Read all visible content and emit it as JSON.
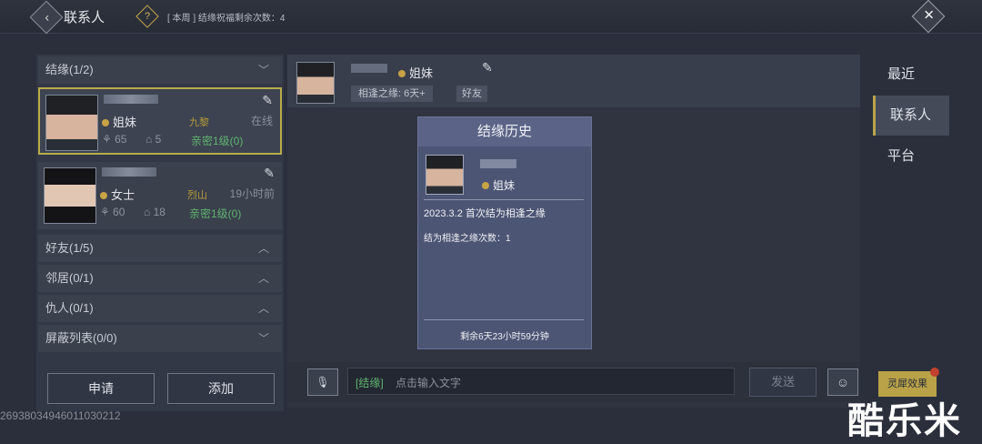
{
  "header": {
    "back_icon": "chevron-left-icon",
    "title": "联系人",
    "help_icon": "question-icon",
    "week_note": "[ 本周 ] 结缘祝福剩余次数：4",
    "close_icon": "close-icon"
  },
  "groups": {
    "jieyuan": "结缘(1/2)",
    "friends": "好友(1/5)",
    "neighbors": "邻居(0/1)",
    "enemies": "仇人(0/1)",
    "blocked": "屏蔽列表(0/0)"
  },
  "contacts": [
    {
      "relation": "姐妹",
      "school": "九黎",
      "status": "在线",
      "stat1": "65",
      "stat2": "5",
      "intimacy": "亲密1级(0)"
    },
    {
      "relation": "女士",
      "school": "烈山",
      "status": "19小时前",
      "stat1": "60",
      "stat2": "18",
      "intimacy": "亲密1级(0)"
    }
  ],
  "buttons": {
    "apply": "申请",
    "add": "添加",
    "send": "发送",
    "effect": "灵犀效果"
  },
  "id_text": "2693803494601103021​2",
  "chat": {
    "relation": "姐妹",
    "tag_meet": "相逢之缘: 6天+",
    "tag_friend": "好友",
    "channel": "[结缘]",
    "placeholder": "点击输入文字"
  },
  "history": {
    "title": "结缘历史",
    "relation": "姐妹",
    "date_line": "2023.3.2  首次结为相逢之缘",
    "count_line": "结为相逢之缘次数：1",
    "remaining": "剩余6天23小时59分钟"
  },
  "tabs": [
    "最近",
    "联系人",
    "平台"
  ],
  "watermark": "酷乐米",
  "colors": {
    "accent_gold": "#b9a44a",
    "intimacy_green": "#5fb470",
    "panel": "#4d5574"
  }
}
